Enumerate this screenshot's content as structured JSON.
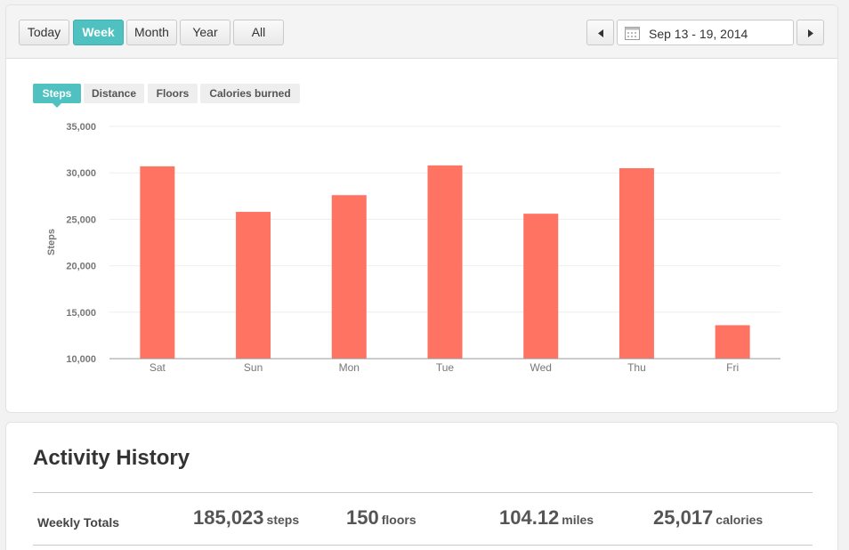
{
  "toolbar": {
    "ranges": [
      "Today",
      "Week",
      "Month",
      "Year",
      "All"
    ],
    "active_range": "Week",
    "date_range": "Sep 13 - 19, 2014",
    "prev_icon": "triangle-left-icon",
    "next_icon": "triangle-right-icon",
    "calendar_icon": "calendar-icon"
  },
  "metric_tabs": [
    "Steps",
    "Distance",
    "Floors",
    "Calories burned"
  ],
  "active_metric": "Steps",
  "colors": {
    "accent": "#4fc1c0",
    "bar": "#ff7363"
  },
  "chart_data": {
    "type": "bar",
    "categories": [
      "Sat",
      "Sun",
      "Mon",
      "Tue",
      "Wed",
      "Thu",
      "Fri"
    ],
    "values": [
      30700,
      25800,
      27600,
      30800,
      25600,
      30500,
      13600
    ],
    "ylabel": "Steps",
    "ylim": [
      10000,
      35000
    ],
    "yticks": [
      "10,000",
      "15,000",
      "20,000",
      "25,000",
      "30,000",
      "35,000"
    ],
    "ytick_values": [
      10000,
      15000,
      20000,
      25000,
      30000,
      35000
    ],
    "grid": true
  },
  "history": {
    "title": "Activity History",
    "totals_label": "Weekly Totals",
    "totals": [
      {
        "value": "185,023",
        "unit": "steps"
      },
      {
        "value": "150",
        "unit": "floors"
      },
      {
        "value": "104.12",
        "unit": "miles"
      },
      {
        "value": "25,017",
        "unit": "calories"
      }
    ]
  }
}
